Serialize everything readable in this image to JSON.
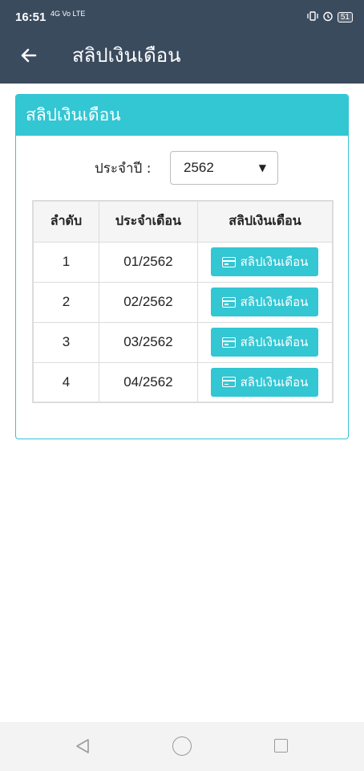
{
  "status_bar": {
    "time": "16:51",
    "network_a": "4G",
    "network_b": "Vo LTE",
    "battery": "51"
  },
  "app_bar": {
    "title": "สลิปเงินเดือน"
  },
  "card": {
    "header": "สลิปเงินเดือน",
    "year_label": "ประจำปี :",
    "year_value": "2562"
  },
  "table": {
    "headers": [
      "ลำดับ",
      "ประจำเดือน",
      "สลิปเงินเดือน"
    ],
    "rows": [
      {
        "no": "1",
        "month": "01/2562",
        "button": "สลิปเงินเดือน"
      },
      {
        "no": "2",
        "month": "02/2562",
        "button": "สลิปเงินเดือน"
      },
      {
        "no": "3",
        "month": "03/2562",
        "button": "สลิปเงินเดือน"
      },
      {
        "no": "4",
        "month": "04/2562",
        "button": "สลิปเงินเดือน"
      }
    ]
  },
  "colors": {
    "app_bar": "#3b4b5e",
    "accent": "#33c6d3"
  }
}
